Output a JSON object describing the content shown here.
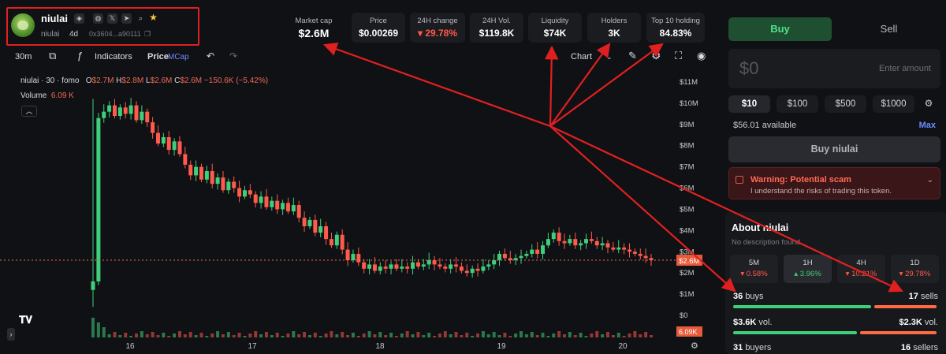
{
  "token": {
    "name": "niulai",
    "symbol": "niulai",
    "age": "4d",
    "address": "0x3604...a90111"
  },
  "stats": [
    {
      "label": "Market cap",
      "value": "$2.6M"
    },
    {
      "label": "Price",
      "value": "$0.00269"
    },
    {
      "label": "24H change",
      "value": "▾ 29.78%"
    },
    {
      "label": "24H Vol.",
      "value": "$119.8K"
    },
    {
      "label": "Liquidity",
      "value": "$74K"
    },
    {
      "label": "Holders",
      "value": "3K"
    },
    {
      "label": "Top 10 holding",
      "value": "84.83%"
    }
  ],
  "toolbar": {
    "interval": "30m",
    "indicators": "Indicators",
    "price": "Price",
    "mcap": "MCap",
    "chart_select": "Chart"
  },
  "chart_header": {
    "symbol": "niulai · 30 · fomo",
    "o": "$2.7M",
    "h": "$2.8M",
    "l": "$2.6M",
    "c": "$2.6M",
    "change": "−150.6K (−5.42%)",
    "volume_label": "Volume",
    "volume_value": "6.09 K"
  },
  "chart_data": {
    "type": "candlestick",
    "y_axis_labels": [
      "$11M",
      "$10M",
      "$9M",
      "$8M",
      "$7M",
      "$6M",
      "$5M",
      "$4M",
      "$3M",
      "$2M",
      "$1M",
      "$0"
    ],
    "x_axis_labels": [
      "16",
      "17",
      "18",
      "19",
      "20"
    ],
    "ylim": [
      0,
      11
    ],
    "y_unit": "$M",
    "current_price_label": "$2.6M",
    "current_volume_label": "6.09K",
    "close_series": [
      1.6,
      9.3,
      9.6,
      9.9,
      9.4,
      9.8,
      9.5,
      9.9,
      9.2,
      9.6,
      9.1,
      8.6,
      8.1,
      8.4,
      7.8,
      8.2,
      7.6,
      7.1,
      6.6,
      7.0,
      6.4,
      6.8,
      6.2,
      6.5,
      5.9,
      6.3,
      6.0,
      5.6,
      5.9,
      5.7,
      5.3,
      5.6,
      5.1,
      5.4,
      5.0,
      5.3,
      4.9,
      5.2,
      4.6,
      4.2,
      4.5,
      3.9,
      4.2,
      3.6,
      3.3,
      3.8,
      3.1,
      2.6,
      2.9,
      2.5,
      2.2,
      2.4,
      2.1,
      2.3,
      2.2,
      2.4,
      2.2,
      2.3,
      2.2,
      2.5,
      2.3,
      2.4,
      2.6,
      2.4,
      2.3,
      2.2,
      2.4,
      2.3,
      2.1,
      2.0,
      2.2,
      2.1,
      2.3,
      2.4,
      2.6,
      2.9,
      2.7,
      2.6,
      2.7,
      2.8,
      2.9,
      3.1,
      2.9,
      3.3,
      3.6,
      3.9,
      3.5,
      3.4,
      3.6,
      3.3,
      3.4,
      3.6,
      3.5,
      3.3,
      3.4,
      3.2,
      3.1,
      3.2,
      3.1,
      3.0,
      2.9,
      2.8,
      2.7,
      2.6
    ]
  },
  "trade": {
    "buy_tab": "Buy",
    "sell_tab": "Sell",
    "amount": "$0",
    "amount_placeholder": "Enter amount",
    "presets": [
      "$10",
      "$100",
      "$500",
      "$1000"
    ],
    "available": "$56.01 available",
    "max": "Max",
    "buy_button": "Buy niulai",
    "warning_title": "Warning: Potential scam",
    "warning_text": "I understand the risks of trading this token."
  },
  "about": {
    "title": "About niulai",
    "description": "No description found",
    "timeframes": [
      {
        "label": "5M",
        "change": "▾ 0.58%",
        "dir": "down"
      },
      {
        "label": "1H",
        "change": "▴ 3.96%",
        "dir": "up"
      },
      {
        "label": "4H",
        "change": "▾ 10.21%",
        "dir": "down"
      },
      {
        "label": "1D",
        "change": "▾ 29.78%",
        "dir": "down"
      }
    ],
    "buys_count": "36",
    "buys_word": "buys",
    "sells_count": "17",
    "sells_word": "sells",
    "buy_vol": "$3.6K",
    "sell_vol": "$2.3K",
    "vol_word": "vol.",
    "buyers_count": "31",
    "buyers_word": "buyers",
    "sellers_count": "16",
    "sellers_word": "sellers",
    "buy_share": 0.68,
    "vol_buy_share": 0.61
  },
  "colors": {
    "up": "#3fcf7c",
    "down": "#ff5a4c",
    "annotation": "#e02020"
  }
}
